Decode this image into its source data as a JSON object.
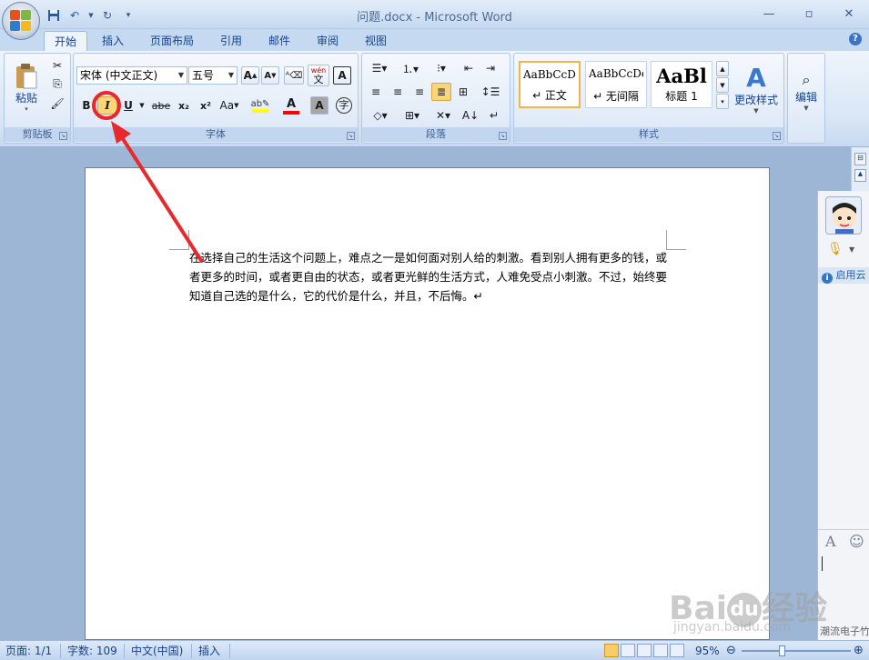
{
  "window": {
    "title": "问题.docx - Microsoft Word",
    "controls": [
      "_",
      "▫",
      "✕"
    ]
  },
  "qat": {
    "save_icon": "save-icon",
    "undo_icon": "undo-icon",
    "redo_icon": "redo-icon",
    "customize_icon": "customize-icon"
  },
  "tabs": [
    "开始",
    "插入",
    "页面布局",
    "引用",
    "邮件",
    "审阅",
    "视图"
  ],
  "active_tab": "开始",
  "clipboard": {
    "paste_label": "粘贴",
    "group_label": "剪贴板"
  },
  "font": {
    "family": "宋体 (中文正文)",
    "size": "五号",
    "group_label": "字体",
    "bold": "B",
    "italic": "I",
    "underline": "U",
    "strike": "abe",
    "subscript": "x₂",
    "superscript": "x²",
    "change_case": "Aa",
    "grow": "A",
    "shrink": "A",
    "phonetic": "wén",
    "phonetic_char": "文",
    "border_char": "A",
    "shade_char": "A",
    "enclose_char": "字"
  },
  "paragraph": {
    "group_label": "段落"
  },
  "styles": {
    "group_label": "样式",
    "items": [
      {
        "sample": "AaBbCcDc",
        "name": "↵ 正文"
      },
      {
        "sample": "AaBbCcDc",
        "name": "↵ 无间隔"
      },
      {
        "sample": "AaBl",
        "name": "标题 1"
      }
    ],
    "change_styles": "更改样式"
  },
  "editing": {
    "label": "编辑"
  },
  "document": {
    "text": "在选择自己的生活这个问题上，难点之一是如何面对别人给的刺激。看到别人拥有更多的钱，或者更多的时间，或者更自由的状态，或者更光鲜的生活方式，人难免受点小刺激。不过，始终要知道自己选的是什么，它的代价是什么，并且，不后悔。↵"
  },
  "side_panel": {
    "info_text": "启用云",
    "bottom_text": "潮流电子竹"
  },
  "status": {
    "page": "页面: 1/1",
    "words": "字数: 109",
    "language": "中文(中国)",
    "mode": "插入",
    "zoom": "95%"
  },
  "watermark": {
    "main": "Bai du 经验",
    "sub": "jingyan.baidu.com"
  },
  "colors": {
    "highlight": "#ffff00",
    "font_color": "#ff0000",
    "annotation": "#e8282d"
  }
}
